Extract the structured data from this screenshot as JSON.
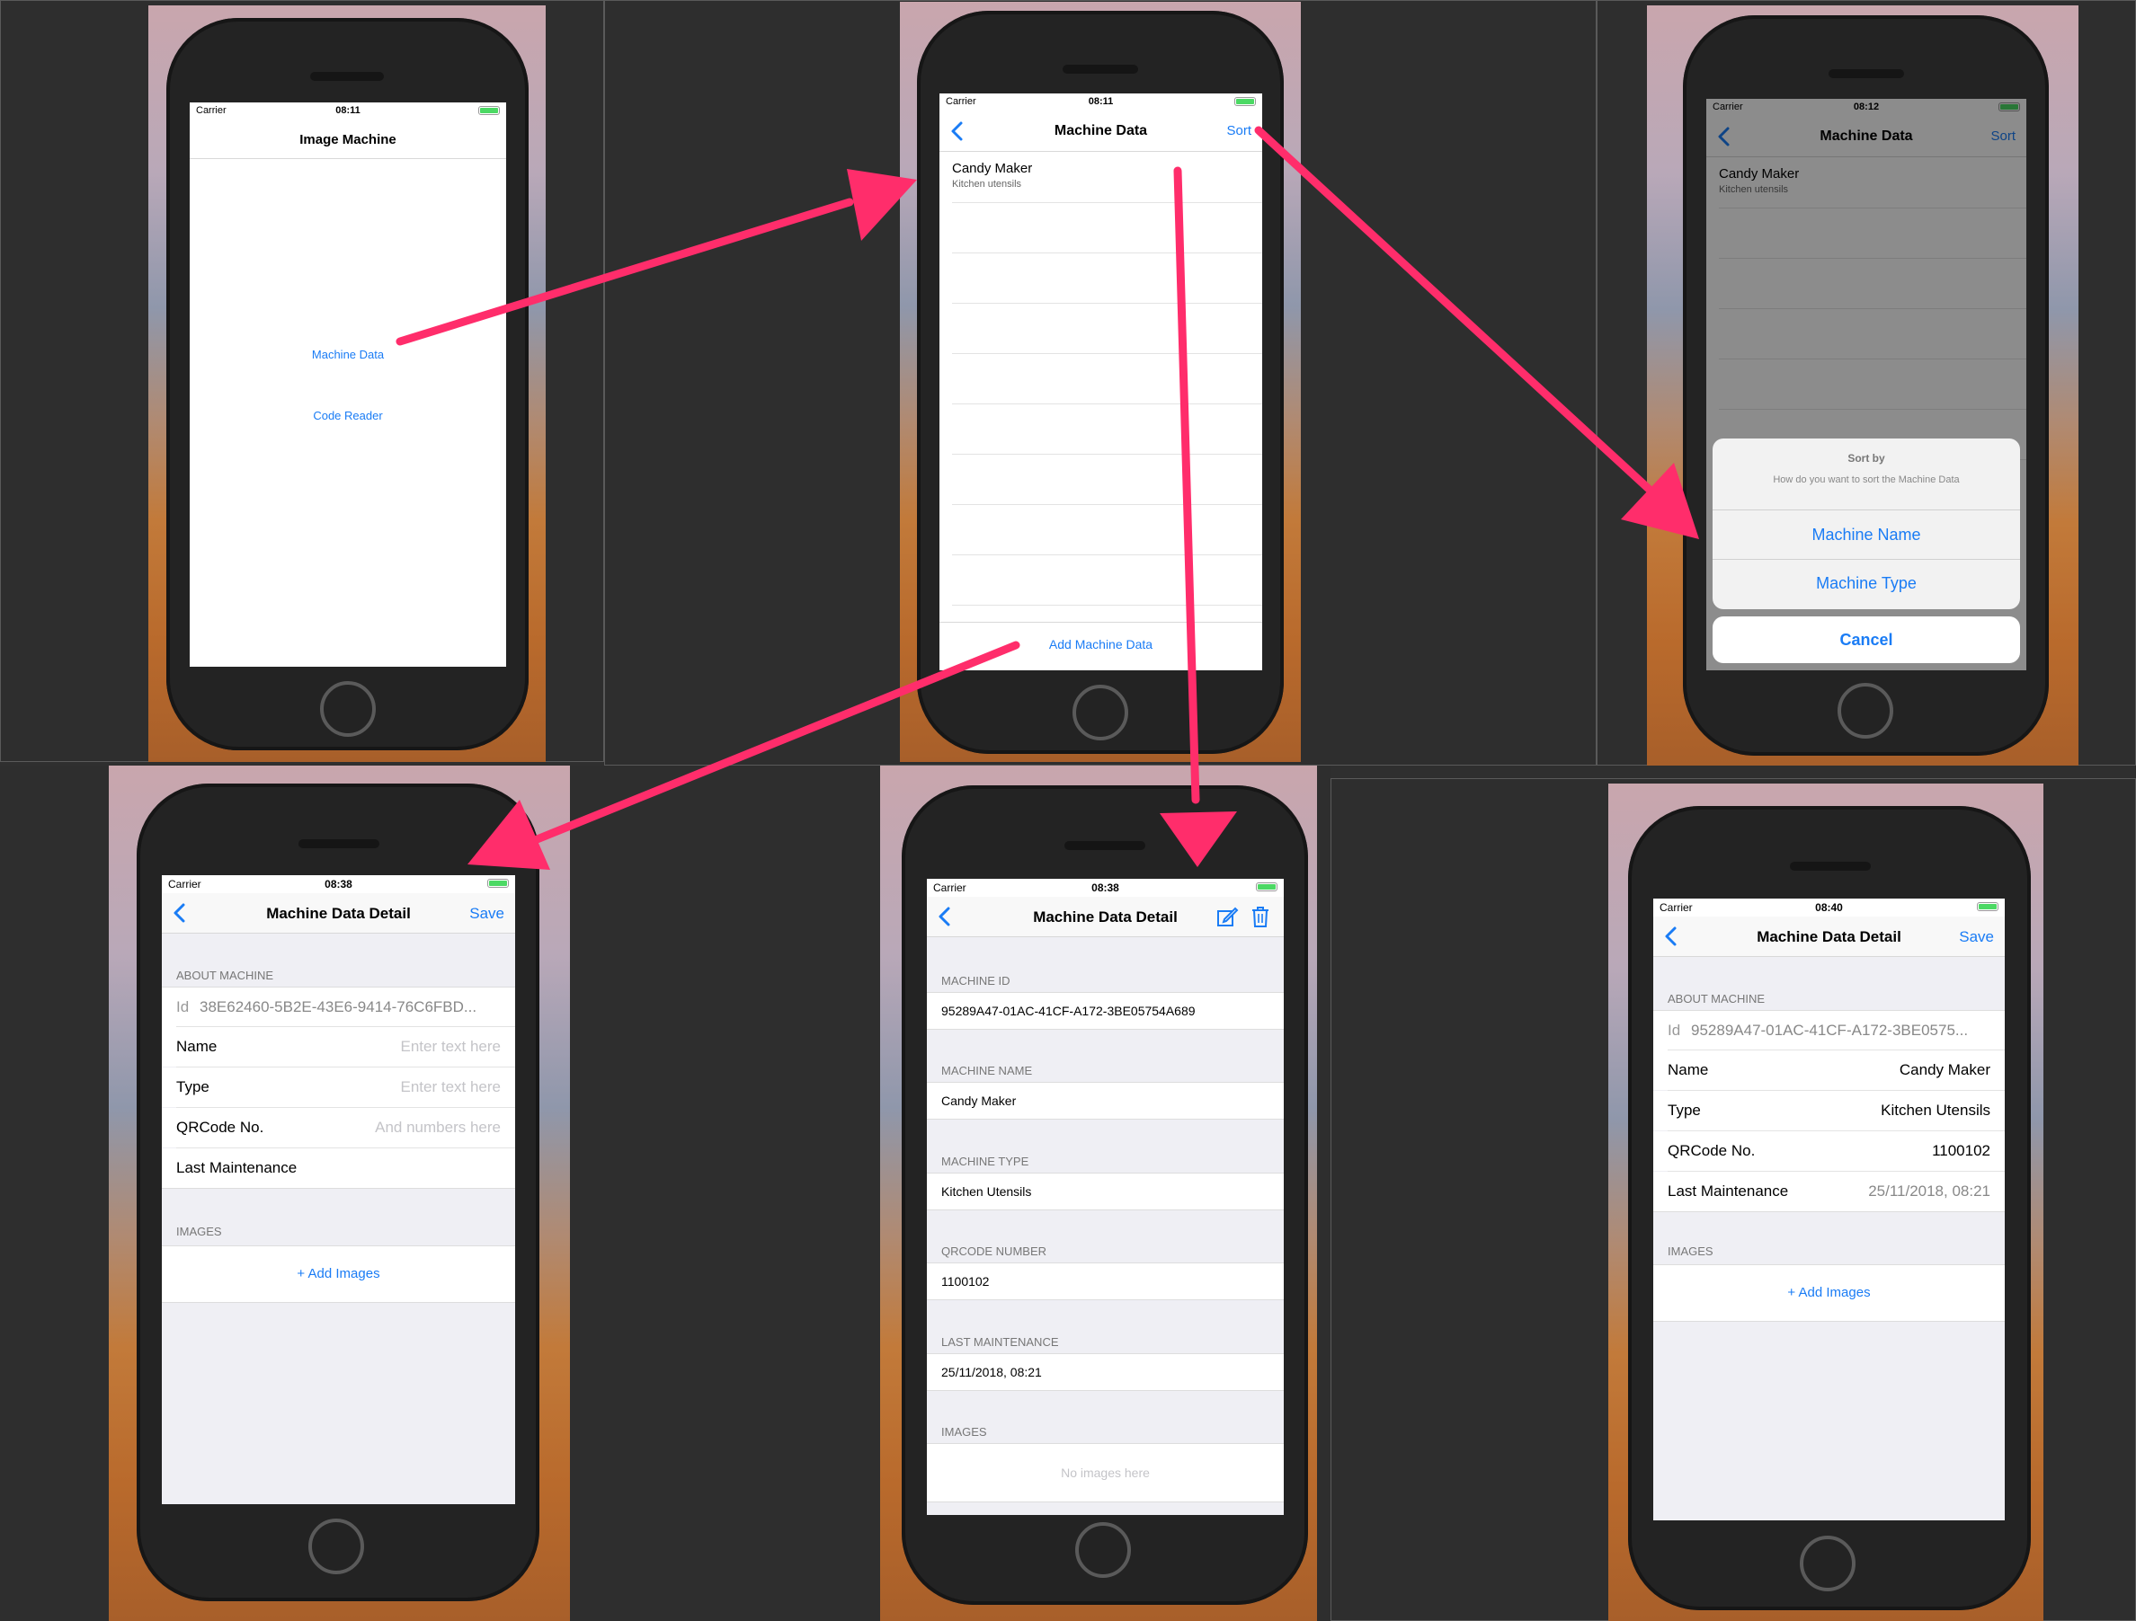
{
  "colors": {
    "accent": "#1a7cf5",
    "arrow": "#ff2d6b",
    "battery": "#4cd964"
  },
  "screen1": {
    "status": {
      "carrier": "Carrier",
      "time": "08:11"
    },
    "title": "Image Machine",
    "buttons": [
      "Machine Data",
      "Code Reader"
    ]
  },
  "screen2": {
    "status": {
      "carrier": "Carrier",
      "time": "08:11"
    },
    "title": "Machine Data",
    "sort_label": "Sort",
    "rows": [
      {
        "name": "Candy Maker",
        "type": "Kitchen utensils"
      }
    ],
    "add_label": "Add Machine Data"
  },
  "screen3": {
    "status": {
      "carrier": "Carrier",
      "time": "08:12"
    },
    "title": "Machine Data",
    "sort_label": "Sort",
    "rows": [
      {
        "name": "Candy Maker",
        "type": "Kitchen utensils"
      }
    ],
    "sheet": {
      "title": "Sort by",
      "message": "How do you want to sort the Machine Data",
      "options": [
        "Machine Name",
        "Machine Type"
      ],
      "cancel": "Cancel"
    }
  },
  "screen4": {
    "status": {
      "carrier": "Carrier",
      "time": "08:38"
    },
    "title": "Machine Data Detail",
    "save_label": "Save",
    "about_header": "ABOUT MACHINE",
    "id_label": "Id",
    "id_value": "38E62460-5B2E-43E6-9414-76C6FBD...",
    "fields": [
      {
        "label": "Name",
        "placeholder": "Enter text here"
      },
      {
        "label": "Type",
        "placeholder": "Enter text here"
      },
      {
        "label": "QRCode No.",
        "placeholder": "And numbers here"
      },
      {
        "label": "Last Maintenance",
        "placeholder": ""
      }
    ],
    "images_header": "IMAGES",
    "add_images": "+ Add Images"
  },
  "screen5": {
    "status": {
      "carrier": "Carrier",
      "time": "08:38"
    },
    "title": "Machine Data Detail",
    "sections": [
      {
        "header": "MACHINE ID",
        "value": "95289A47-01AC-41CF-A172-3BE05754A689"
      },
      {
        "header": "MACHINE NAME",
        "value": "Candy Maker"
      },
      {
        "header": "MACHINE TYPE",
        "value": "Kitchen Utensils"
      },
      {
        "header": "QRCODE NUMBER",
        "value": "1100102"
      },
      {
        "header": "LAST MAINTENANCE",
        "value": "25/11/2018, 08:21"
      }
    ],
    "images_header": "IMAGES",
    "no_images": "No images here"
  },
  "screen6": {
    "status": {
      "carrier": "Carrier",
      "time": "08:40"
    },
    "title": "Machine Data Detail",
    "save_label": "Save",
    "about_header": "ABOUT MACHINE",
    "id_label": "Id",
    "id_value": "95289A47-01AC-41CF-A172-3BE0575...",
    "fields": [
      {
        "label": "Name",
        "value": "Candy Maker"
      },
      {
        "label": "Type",
        "value": "Kitchen Utensils"
      },
      {
        "label": "QRCode No.",
        "value": "1100102"
      },
      {
        "label": "Last Maintenance",
        "value": "25/11/2018, 08:21"
      }
    ],
    "images_header": "IMAGES",
    "add_images": "+ Add Images"
  }
}
